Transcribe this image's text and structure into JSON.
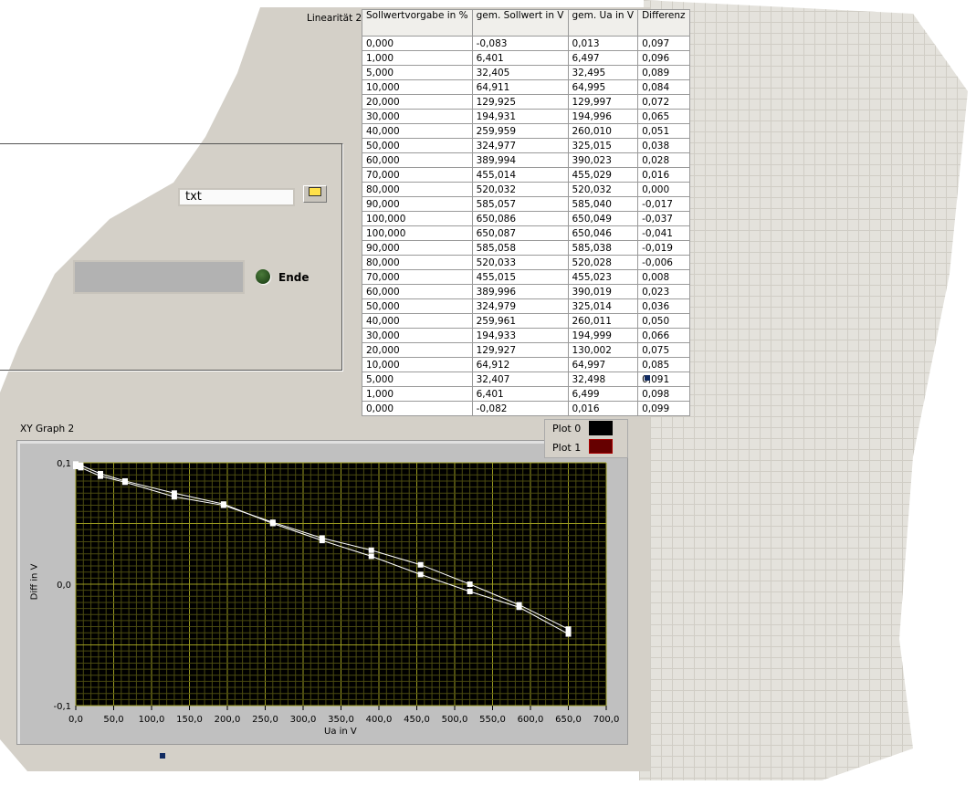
{
  "table": {
    "label": "Linearität 2",
    "headers": [
      "Sollwertvorgabe in %",
      "gem. Sollwert in V",
      "gem. Ua in V",
      "Differenz"
    ],
    "rows": [
      [
        "0,000",
        "-0,083",
        "0,013",
        "0,097"
      ],
      [
        "1,000",
        "6,401",
        "6,497",
        "0,096"
      ],
      [
        "5,000",
        "32,405",
        "32,495",
        "0,089"
      ],
      [
        "10,000",
        "64,911",
        "64,995",
        "0,084"
      ],
      [
        "20,000",
        "129,925",
        "129,997",
        "0,072"
      ],
      [
        "30,000",
        "194,931",
        "194,996",
        "0,065"
      ],
      [
        "40,000",
        "259,959",
        "260,010",
        "0,051"
      ],
      [
        "50,000",
        "324,977",
        "325,015",
        "0,038"
      ],
      [
        "60,000",
        "389,994",
        "390,023",
        "0,028"
      ],
      [
        "70,000",
        "455,014",
        "455,029",
        "0,016"
      ],
      [
        "80,000",
        "520,032",
        "520,032",
        "0,000"
      ],
      [
        "90,000",
        "585,057",
        "585,040",
        "-0,017"
      ],
      [
        "100,000",
        "650,086",
        "650,049",
        "-0,037"
      ],
      [
        "100,000",
        "650,087",
        "650,046",
        "-0,041"
      ],
      [
        "90,000",
        "585,058",
        "585,038",
        "-0,019"
      ],
      [
        "80,000",
        "520,033",
        "520,028",
        "-0,006"
      ],
      [
        "70,000",
        "455,015",
        "455,023",
        "0,008"
      ],
      [
        "60,000",
        "389,996",
        "390,019",
        "0,023"
      ],
      [
        "50,000",
        "324,979",
        "325,014",
        "0,036"
      ],
      [
        "40,000",
        "259,961",
        "260,011",
        "0,050"
      ],
      [
        "30,000",
        "194,933",
        "194,999",
        "0,066"
      ],
      [
        "20,000",
        "129,927",
        "130,002",
        "0,075"
      ],
      [
        "10,000",
        "64,912",
        "64,997",
        "0,085"
      ],
      [
        "5,000",
        "32,407",
        "32,498",
        "0,091"
      ],
      [
        "1,000",
        "6,401",
        "6,499",
        "0,098"
      ],
      [
        "0,000",
        "-0,082",
        "0,016",
        "0,099"
      ]
    ]
  },
  "path_field": {
    "value": "txt"
  },
  "led": {
    "label": "Ende"
  },
  "graph": {
    "title": "XY Graph 2",
    "legend": [
      "Plot 0",
      "Plot 1"
    ]
  },
  "chart_data": {
    "type": "line",
    "title": "XY Graph 2",
    "xlabel": "Ua in V",
    "ylabel": "Diff in V",
    "xlim": [
      0,
      700
    ],
    "ylim": [
      -0.1,
      0.1
    ],
    "xticks": [
      "0,0",
      "50,0",
      "100,0",
      "150,0",
      "200,0",
      "250,0",
      "300,0",
      "350,0",
      "400,0",
      "450,0",
      "500,0",
      "550,0",
      "600,0",
      "650,0",
      "700,0"
    ],
    "yticks": [
      "0,1",
      "0,0",
      "-0,1"
    ],
    "grid": true,
    "legend_position": "top-right",
    "series": [
      {
        "name": "Plot 0",
        "x": [
          0.013,
          6.497,
          32.495,
          64.995,
          129.997,
          194.996,
          260.01,
          325.015,
          390.023,
          455.029,
          520.032,
          585.04,
          650.049
        ],
        "y": [
          0.097,
          0.096,
          0.089,
          0.084,
          0.072,
          0.065,
          0.051,
          0.038,
          0.028,
          0.016,
          0.0,
          -0.017,
          -0.037
        ]
      },
      {
        "name": "Plot 1",
        "x": [
          650.046,
          585.038,
          520.028,
          455.023,
          390.019,
          325.014,
          260.011,
          194.999,
          130.002,
          64.997,
          32.498,
          6.499,
          0.016
        ],
        "y": [
          -0.041,
          -0.019,
          -0.006,
          0.008,
          0.023,
          0.036,
          0.05,
          0.066,
          0.075,
          0.085,
          0.091,
          0.098,
          0.099
        ]
      }
    ]
  }
}
